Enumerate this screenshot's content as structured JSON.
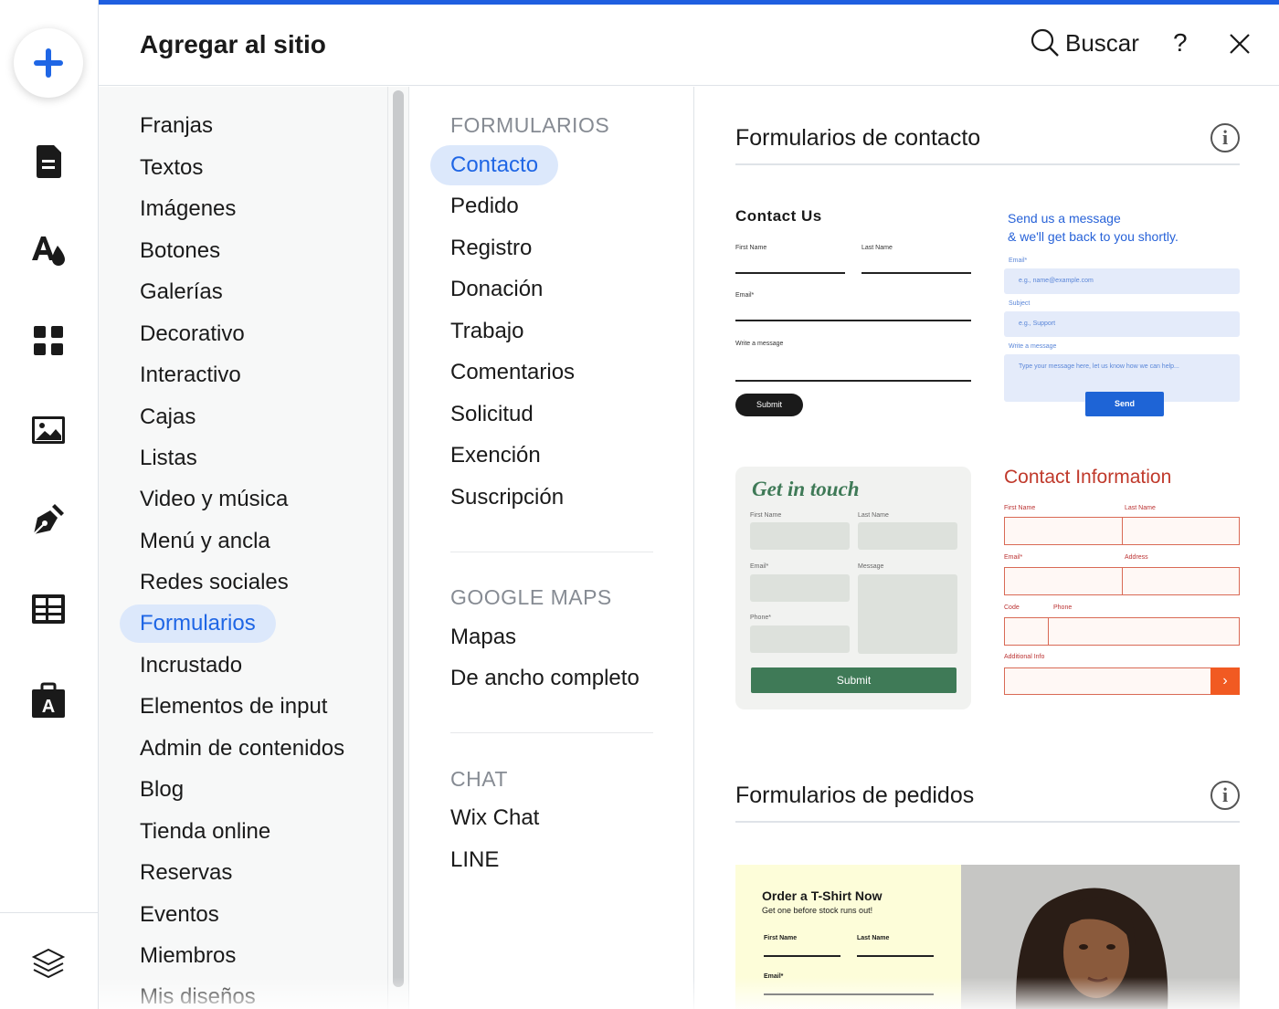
{
  "header": {
    "title": "Agregar al sitio",
    "search_label": "Buscar",
    "help_label": "?"
  },
  "rail": {
    "icons": [
      "add-icon",
      "page-icon",
      "theme-icon",
      "apps-icon",
      "media-icon",
      "pen-icon",
      "table-icon",
      "store-icon",
      "layers-icon"
    ]
  },
  "categories": {
    "items": [
      "Franjas",
      "Textos",
      "Imágenes",
      "Botones",
      "Galerías",
      "Decorativo",
      "Interactivo",
      "Cajas",
      "Listas",
      "Video y música",
      "Menú y ancla",
      "Redes sociales",
      "Formularios",
      "Incrustado",
      "Elementos de input",
      "Admin de contenidos",
      "Blog",
      "Tienda online",
      "Reservas",
      "Eventos",
      "Miembros",
      "Mis diseños"
    ],
    "active": "Formularios"
  },
  "subcategories": {
    "forms_heading": "FORMULARIOS",
    "forms": [
      "Contacto",
      "Pedido",
      "Registro",
      "Donación",
      "Trabajo",
      "Comentarios",
      "Solicitud",
      "Exención",
      "Suscripción"
    ],
    "maps_heading": "GOOGLE MAPS",
    "maps": [
      "Mapas",
      "De ancho completo"
    ],
    "chat_heading": "CHAT",
    "chat": [
      "Wix Chat",
      "LINE"
    ],
    "active": "Contacto"
  },
  "preview": {
    "section1_title": "Formularios de contacto",
    "section2_title": "Formularios de pedidos",
    "info_glyph": "i",
    "card1": {
      "title": "Contact Us",
      "first_name": "First Name",
      "last_name": "Last Name",
      "email": "Email*",
      "message": "Write a message",
      "submit": "Submit"
    },
    "card2": {
      "line1": "Send us a message",
      "line2": "& we'll get back to you shortly.",
      "email_label": "Email*",
      "email_placeholder": "e.g., name@example.com",
      "subject_label": "Subject",
      "subject_placeholder": "e.g., Support",
      "message_label": "Write a message",
      "message_placeholder": "Type your message here, let us know how we can help...",
      "send": "Send"
    },
    "card3": {
      "title": "Get in touch",
      "first_name": "First Name",
      "last_name": "Last Name",
      "email": "Email*",
      "message": "Message",
      "phone": "Phone*",
      "submit": "Submit"
    },
    "card4": {
      "title": "Contact Information",
      "first_name": "First Name",
      "last_name": "Last Name",
      "email": "Email*",
      "address": "Address",
      "code": "Code",
      "phone": "Phone",
      "additional": "Additional Info",
      "go": "›"
    },
    "card5": {
      "title": "Order a T-Shirt Now",
      "subtitle": "Get one before stock runs out!",
      "first_name": "First Name",
      "last_name": "Last Name",
      "email": "Email*"
    }
  },
  "colors": {
    "accent": "#1f66e5",
    "active_bg": "#dce8fb",
    "top_bar": "#1f5fe0"
  }
}
